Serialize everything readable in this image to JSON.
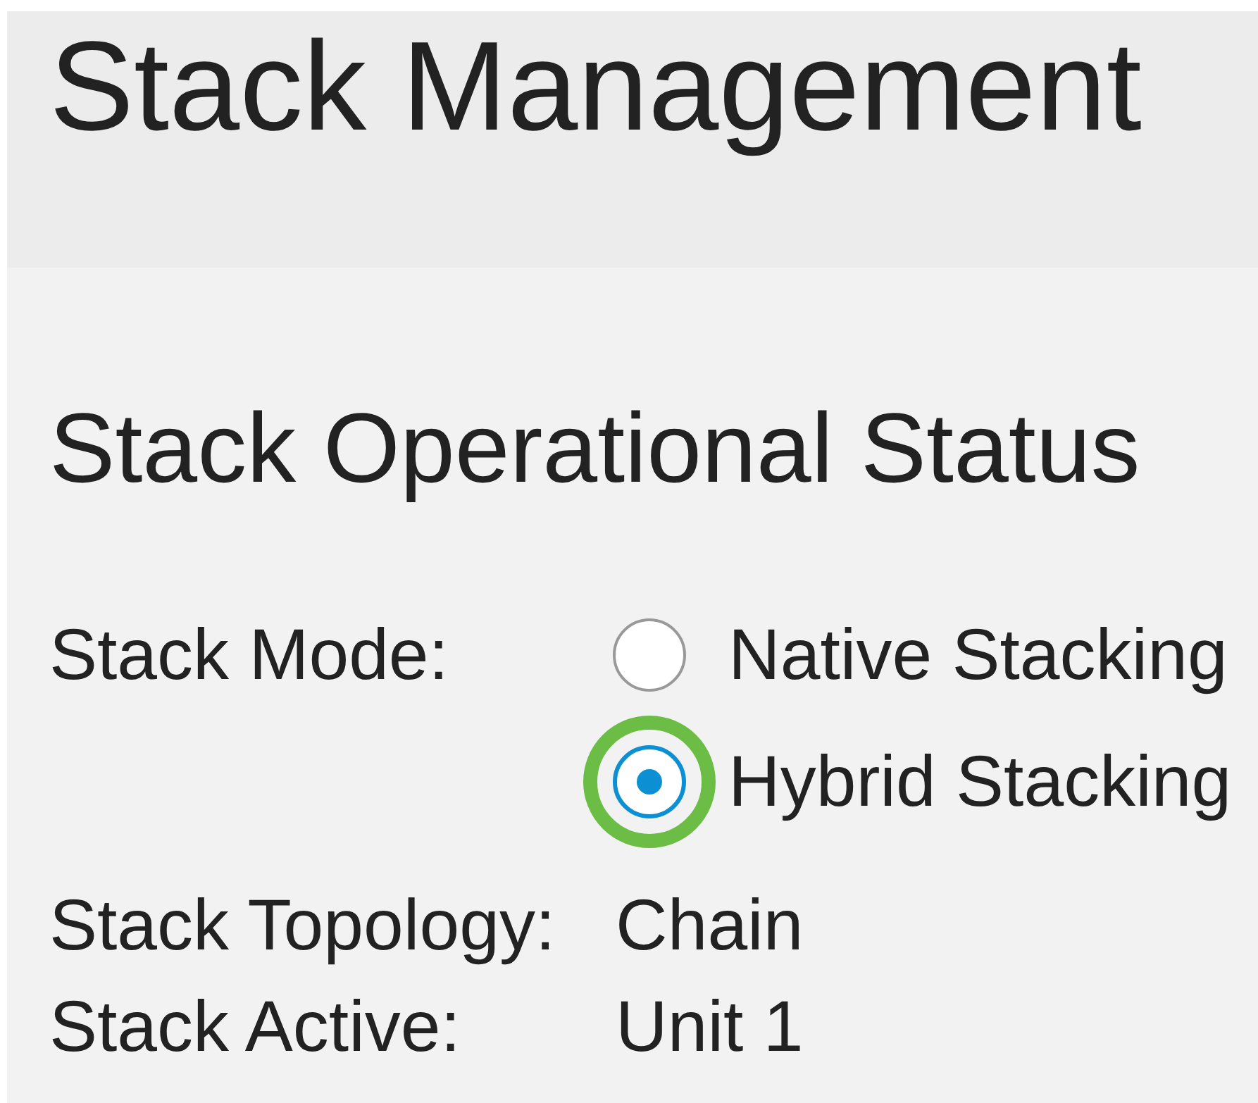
{
  "header": {
    "title": "Stack Management"
  },
  "section": {
    "title": "Stack Operational Status"
  },
  "stack_mode": {
    "label": "Stack Mode:",
    "options": [
      {
        "label": "Native Stacking",
        "selected": false,
        "highlighted": false
      },
      {
        "label": "Hybrid Stacking",
        "selected": true,
        "highlighted": true
      }
    ]
  },
  "fields": [
    {
      "label": "Stack Topology:",
      "value": "Chain"
    },
    {
      "label": "Stack Active:",
      "value": "Unit 1"
    }
  ]
}
